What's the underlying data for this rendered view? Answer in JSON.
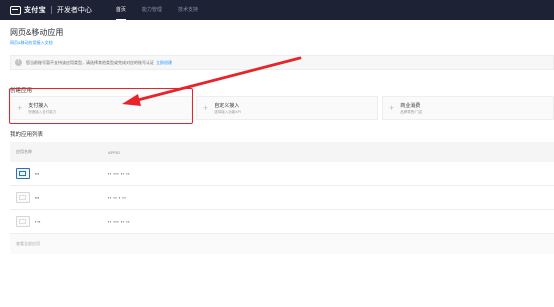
{
  "topbar": {
    "logo_text": "支付宝",
    "logo_sub": "开发者中心",
    "nav": [
      "首页",
      "能力管理",
      "技术支持"
    ]
  },
  "page": {
    "title": "网页&移动应用",
    "subtitle": "网页&移动应用接入文档"
  },
  "notice": {
    "text": "您当前账号暂不支持该应用类型，请选择其他类型或完成对应的账号认证",
    "link": "立即创建"
  },
  "create": {
    "title": "创建应用",
    "cards": [
      {
        "title": "支付接入",
        "desc": "快速接入支付能力"
      },
      {
        "title": "自定义接入",
        "desc": "选择接入功能API"
      },
      {
        "title": "商业消费",
        "desc": "品牌零售/门店"
      }
    ]
  },
  "apps": {
    "title": "我的应用列表",
    "columns": [
      "应用名称",
      "APPID"
    ],
    "rows": [
      {
        "name": "▪▪▪",
        "appid": "▪▪ ▪▪▪ ▪▪ ▪▪"
      },
      {
        "name": "▪▪▪",
        "appid": "▪▪ ▪▪ ▪ ▪▪"
      },
      {
        "name": "▪ ▪▪",
        "appid": "▪▪ ▪▪▪ ▪▪ ▪▪"
      }
    ],
    "footer": "查看全部应用"
  },
  "colors": {
    "topbar": "#1e2235",
    "accent": "#1890ff",
    "annotation": "#e8232a"
  }
}
